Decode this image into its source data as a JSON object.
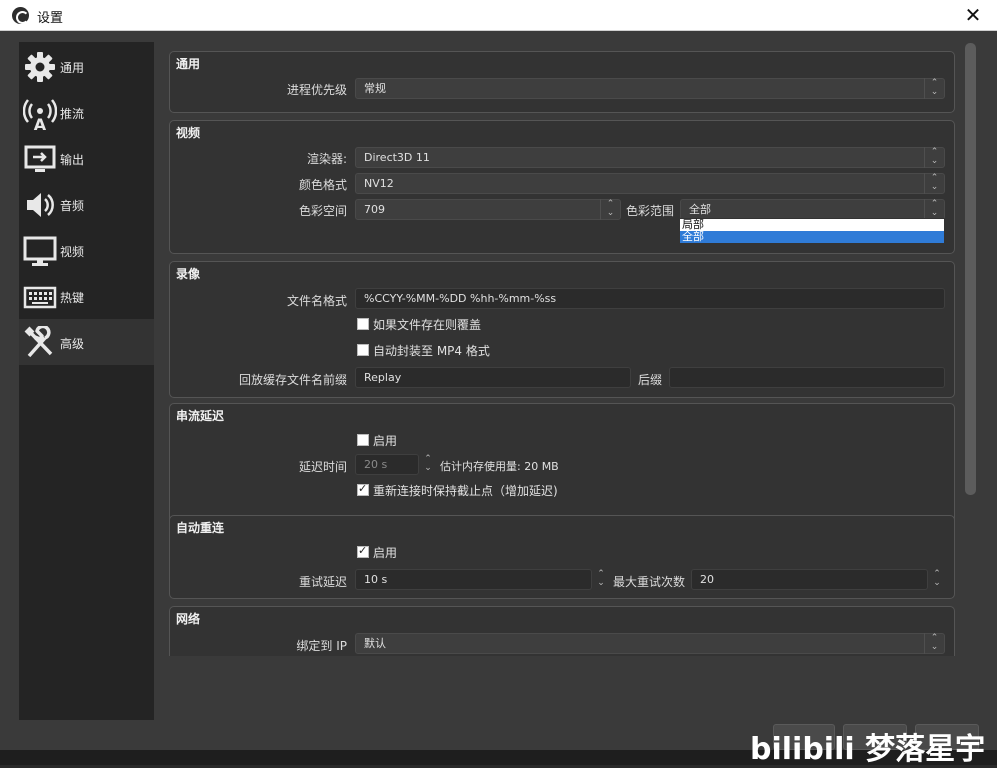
{
  "window": {
    "title": "设置"
  },
  "sidebar": {
    "items": [
      {
        "label": "通用",
        "icon": "gear-icon"
      },
      {
        "label": "推流",
        "icon": "antenna-icon"
      },
      {
        "label": "输出",
        "icon": "monitor-output-icon"
      },
      {
        "label": "音频",
        "icon": "speaker-icon"
      },
      {
        "label": "视频",
        "icon": "monitor-icon"
      },
      {
        "label": "热键",
        "icon": "keyboard-icon"
      },
      {
        "label": "高级",
        "icon": "wrench-screwdriver-icon"
      }
    ],
    "active": "高级"
  },
  "general": {
    "title": "通用",
    "priority_label": "进程优先级",
    "priority_value": "常规"
  },
  "video": {
    "title": "视频",
    "renderer_label": "渲染器:",
    "renderer_value": "Direct3D 11",
    "color_format_label": "颜色格式",
    "color_format_value": "NV12",
    "color_space_label": "色彩空间",
    "color_space_value": "709",
    "color_range_label": "色彩范围",
    "color_range_value": "全部",
    "color_range_options": [
      "局部",
      "全部"
    ]
  },
  "recording": {
    "title": "录像",
    "filename_format_label": "文件名格式",
    "filename_format_value": "%CCYY-%MM-%DD %hh-%mm-%ss",
    "overwrite_label": "如果文件存在则覆盖",
    "overwrite_checked": false,
    "automux_label": "自动封装至 MP4 格式",
    "automux_checked": false,
    "replay_prefix_label": "回放缓存文件名前缀",
    "replay_prefix_value": "Replay",
    "replay_suffix_label": "后缀",
    "replay_suffix_value": ""
  },
  "stream_delay": {
    "title": "串流延迟",
    "enable_label": "启用",
    "enable_checked": false,
    "duration_label": "延迟时间",
    "duration_value": "20 s",
    "memory_estimate": "估计内存使用量: 20 MB",
    "preserve_label": "重新连接时保持截止点（增加延迟)",
    "preserve_checked": true
  },
  "reconnect": {
    "title": "自动重连",
    "enable_label": "启用",
    "enable_checked": true,
    "retry_delay_label": "重试延迟",
    "retry_delay_value": "10 s",
    "max_retries_label": "最大重试次数",
    "max_retries_value": "20"
  },
  "network": {
    "title": "网络",
    "bind_ip_label": "绑定到 IP",
    "bind_ip_value": "默认"
  },
  "watermark": "bilibili 梦落星宇"
}
